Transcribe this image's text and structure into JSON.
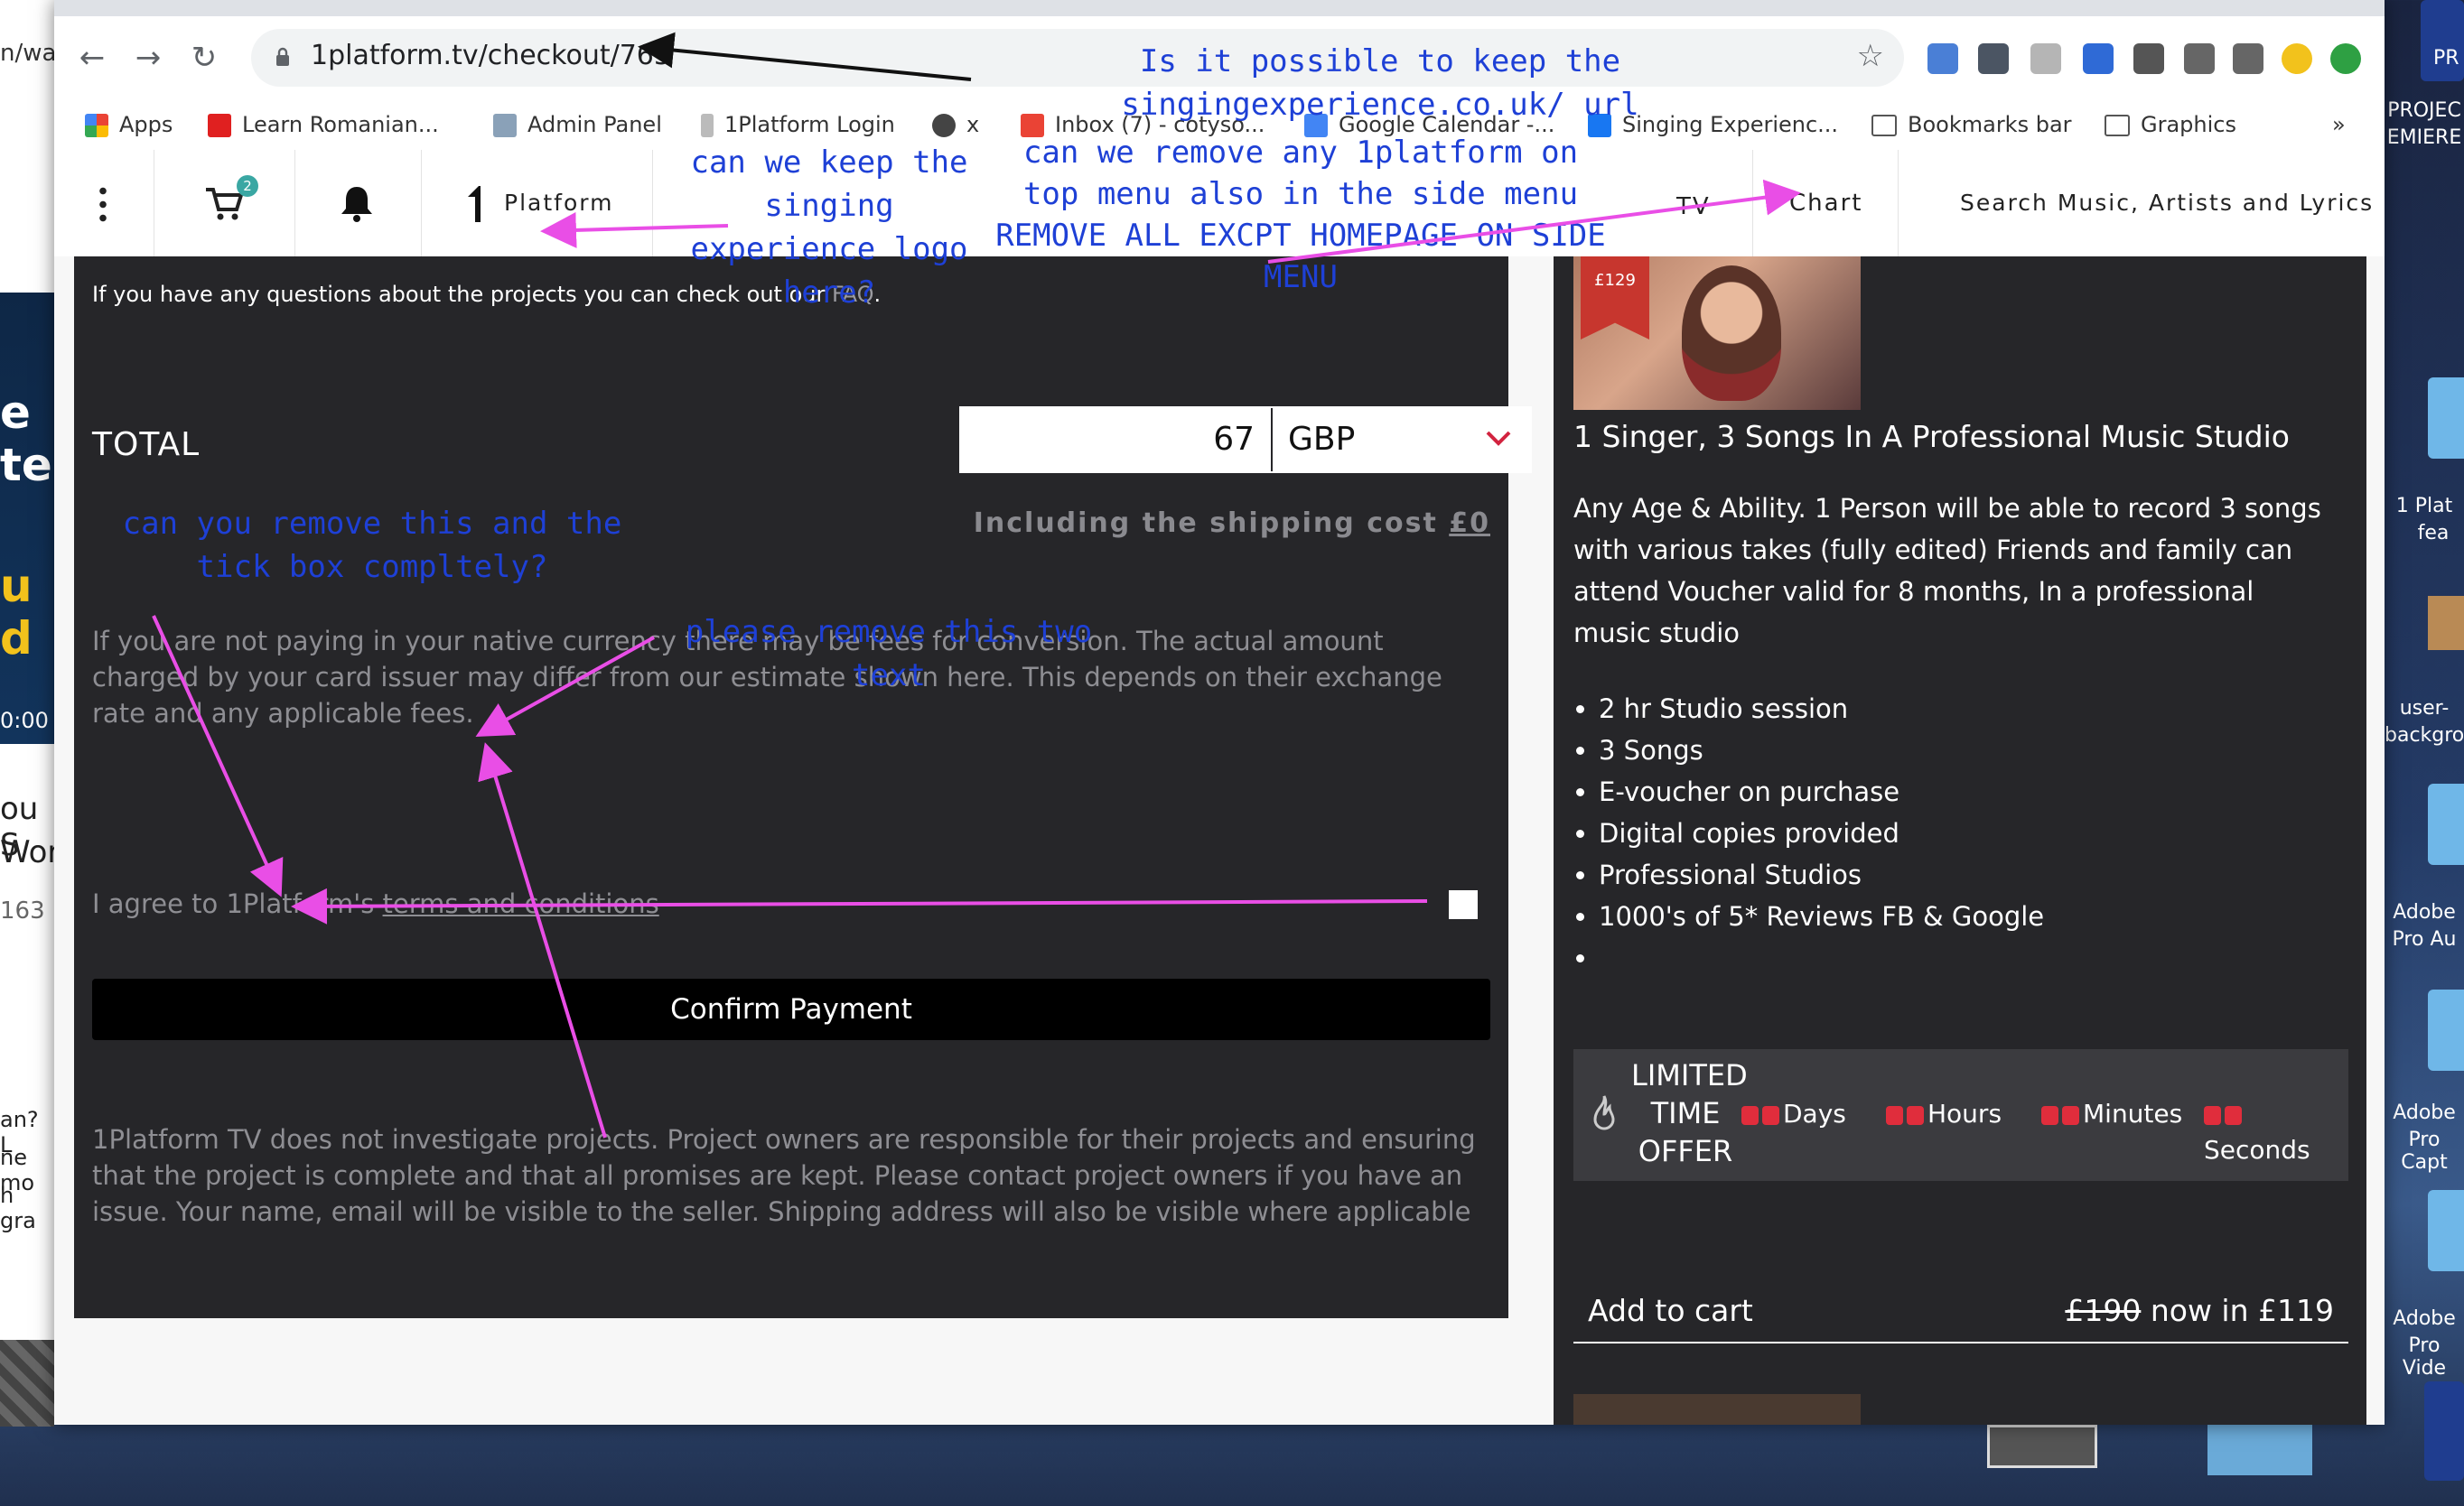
{
  "browser": {
    "url": "1platform.tv/checkout/765",
    "bookmarks": [
      {
        "label": "Apps",
        "icon": "apps-grid-icon"
      },
      {
        "label": "Learn Romanian...",
        "icon": "youtube-icon"
      },
      {
        "label": "Admin Panel",
        "icon": "monitor-icon"
      },
      {
        "label": "1Platform Login",
        "icon": "1platform-icon"
      },
      {
        "label": "x",
        "icon": "globe-icon"
      },
      {
        "label": "Inbox (7) - cotyso...",
        "icon": "gmail-icon"
      },
      {
        "label": "Google Calendar -...",
        "icon": "calendar-icon"
      },
      {
        "label": "Singing Experienc...",
        "icon": "facebook-icon"
      },
      {
        "label": "Bookmarks bar",
        "icon": "folder-icon"
      },
      {
        "label": "Graphics",
        "icon": "folder-icon"
      }
    ],
    "more_bookmarks": "»"
  },
  "header": {
    "cart_badge": "2",
    "logo_text": "Platform",
    "tv_label": "TV",
    "chart_label": "Chart",
    "search_placeholder": "Search Music, Artists and Lyrics"
  },
  "checkout": {
    "faq_prefix": "If you have any questions about the projects you can check out our ",
    "faq_link": "FAQ",
    "faq_suffix": ".",
    "total_label": "TOTAL",
    "total_amount": "67",
    "currency": "GBP",
    "shipping_prefix": "Including the shipping cost ",
    "shipping_value": "£0",
    "conversion_note": "If you are not paying in your native currency there may be fees for conversion. The actual amount charged by your card issuer may differ from our estimate shown here. This depends on their exchange rate and any applicable fees.",
    "agree_prefix": "I agree to 1Platform's ",
    "agree_link": "terms and conditions",
    "confirm_label": "Confirm Payment",
    "disclaimer": "1Platform TV does not investigate projects. Project owners are responsible for their projects and ensuring that the project is complete and that all promises are kept. Please contact project owners if you have an issue. Your name, email will be visible to the seller. Shipping address will also be visible where applicable"
  },
  "product": {
    "price_tag": "£129",
    "title": "1 Singer, 3 Songs In A Professional Music Studio",
    "description": "Any Age & Ability. 1 Person will be able to record 3 songs with various takes (fully edited) Friends and family can attend Voucher valid for 8 months, In a professional music studio",
    "bullets": [
      "2 hr Studio session",
      "3 Songs",
      "E-voucher on purchase",
      "Digital copies provided",
      "Professional Studios",
      "1000's of 5* Reviews FB & Google",
      ""
    ],
    "offer_label": "LIMITED TIME OFFER",
    "countdown": {
      "days": "Days",
      "hours": "Hours",
      "minutes": "Minutes",
      "seconds": "Seconds"
    },
    "add_to_cart": "Add to cart",
    "old_price": "£190",
    "now_in": "now in",
    "new_price": "£119"
  },
  "annotations": {
    "url_note": "Is it possible to keep the singingexperience.co.uk/ url",
    "logo_note": "can we keep the singing experience logo here?",
    "menu_note": "can we remove any 1platform on top menu also in the side menu REMOVE ALL EXCPT HOMEPAGE ON SIDE MENU",
    "tickbox_note": "can you remove this and the tick box compltely?",
    "text_note": "please remove this two  text"
  },
  "desktop": {
    "left_fragments": [
      "n/wa",
      "e te",
      "u d",
      "0:00",
      "ou S",
      "Word",
      "163",
      "an? L",
      "ne mo",
      "h gra"
    ],
    "right_labels": [
      "PR",
      "PROJEC",
      "EMIERE",
      "1 Plat",
      "fea",
      "user-",
      "backgro",
      "Adobe",
      "Pro Au",
      "Adobe",
      "Pro Capt",
      "Adobe",
      "Pro Vide"
    ]
  },
  "colors": {
    "accent_red": "#e02d3c",
    "annotation_blue": "#1e40d6",
    "arrow_magenta": "#e94ee6",
    "panel_dark": "#262629"
  }
}
